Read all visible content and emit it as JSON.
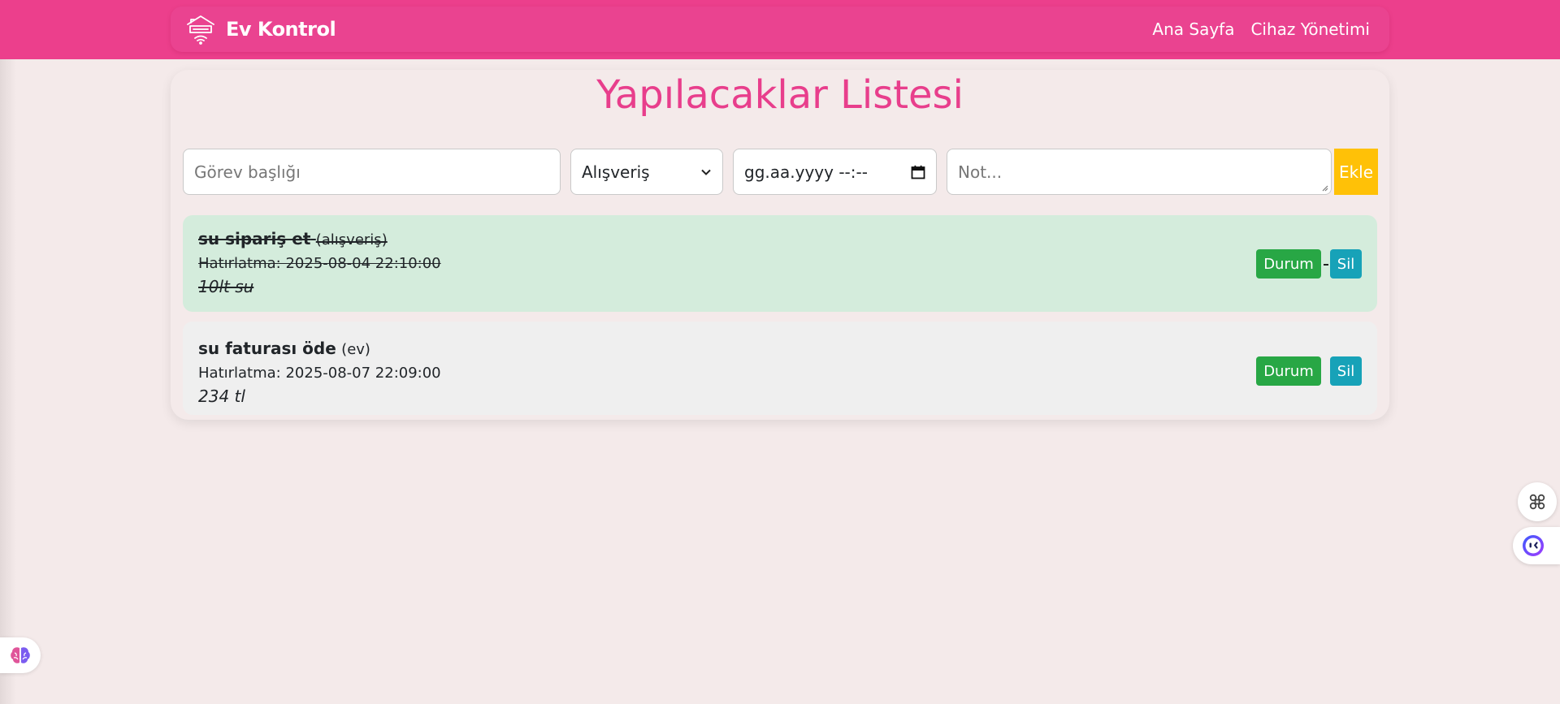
{
  "navbar": {
    "brand": "Ev Kontrol",
    "links": [
      "Ana Sayfa",
      "Cihaz Yönetimi"
    ]
  },
  "page": {
    "title": "Yapılacaklar Listesi"
  },
  "form": {
    "title_placeholder": "Görev başlığı",
    "category_selected": "Alışveriş",
    "datetime_placeholder": "gg.aa.yyyy --:--",
    "note_placeholder": "Not...",
    "add_label": "Ekle"
  },
  "tasks": [
    {
      "name": "su sipariş et",
      "category": "(alışveriş)",
      "reminder": "Hatırlatma: 2025-08-04 22:10:00",
      "note": "10lt su",
      "completed": true,
      "status_label": "Durum",
      "delete_label": "Sil"
    },
    {
      "name": "su faturası öde",
      "category": "(ev)",
      "reminder": "Hatırlatma: 2025-08-07 22:09:00",
      "note": "234 tl",
      "completed": false,
      "status_label": "Durum",
      "delete_label": "Sil"
    }
  ],
  "colors": {
    "navbar": "#ec3f8c",
    "title": "#e83e8c",
    "add_button": "#ffc107",
    "status_button": "#28a745",
    "delete_button": "#17a2b8",
    "completed_bg": "#d4ecdc",
    "pending_bg": "#efefef"
  },
  "icons": {
    "brand": "house-wifi-icon",
    "category_dropdown": "chevron-down-icon",
    "datetime": "calendar-icon",
    "widget_grid": "command-icon",
    "widget_bot": "bot-face-icon",
    "widget_brain": "brain-icon"
  }
}
